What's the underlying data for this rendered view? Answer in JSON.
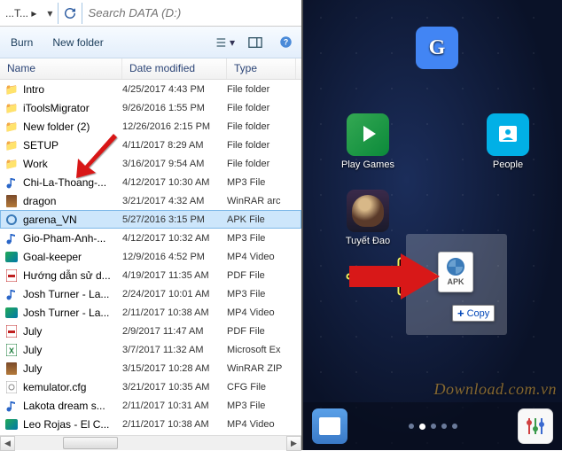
{
  "addr": {
    "crumb": "...T... ▸",
    "search_placeholder": "Search DATA (D:)"
  },
  "toolbar": {
    "burn": "Burn",
    "newfolder": "New folder"
  },
  "headers": {
    "name": "Name",
    "date": "Date modified",
    "type": "Type"
  },
  "files": [
    {
      "icon": "folder",
      "name": "Intro",
      "date": "4/25/2017 4:43 PM",
      "type": "File folder"
    },
    {
      "icon": "folder",
      "name": "iToolsMigrator",
      "date": "9/26/2016 1:55 PM",
      "type": "File folder"
    },
    {
      "icon": "folder",
      "name": "New folder (2)",
      "date": "12/26/2016 2:15 PM",
      "type": "File folder"
    },
    {
      "icon": "folder",
      "name": "SETUP",
      "date": "4/11/2017 8:29 AM",
      "type": "File folder"
    },
    {
      "icon": "folder",
      "name": "Work",
      "date": "3/16/2017 9:54 AM",
      "type": "File folder"
    },
    {
      "icon": "mp3",
      "name": "Chi-La-Thoang-...",
      "date": "4/12/2017 10:30 AM",
      "type": "MP3 File"
    },
    {
      "icon": "rar",
      "name": "dragon",
      "date": "3/21/2017 4:32 AM",
      "type": "WinRAR arc"
    },
    {
      "icon": "apk",
      "name": "garena_VN",
      "date": "5/27/2016 3:15 PM",
      "type": "APK File",
      "selected": true
    },
    {
      "icon": "mp3",
      "name": "Gio-Pham-Anh-...",
      "date": "4/12/2017 10:32 AM",
      "type": "MP3 File"
    },
    {
      "icon": "mp4",
      "name": "Goal-keeper",
      "date": "12/9/2016 4:52 PM",
      "type": "MP4 Video"
    },
    {
      "icon": "pdf",
      "name": "Hướng dẫn sử d...",
      "date": "4/19/2017 11:35 AM",
      "type": "PDF File"
    },
    {
      "icon": "mp3",
      "name": "Josh Turner - La...",
      "date": "2/24/2017 10:01 AM",
      "type": "MP3 File"
    },
    {
      "icon": "mp4",
      "name": "Josh Turner - La...",
      "date": "2/11/2017 10:38 AM",
      "type": "MP4 Video"
    },
    {
      "icon": "pdf",
      "name": "July",
      "date": "2/9/2017 11:47 AM",
      "type": "PDF File"
    },
    {
      "icon": "xls",
      "name": "July",
      "date": "3/7/2017 11:32 AM",
      "type": "Microsoft Ex"
    },
    {
      "icon": "rar",
      "name": "July",
      "date": "3/15/2017 10:28 AM",
      "type": "WinRAR ZIP"
    },
    {
      "icon": "cfg",
      "name": "kemulator.cfg",
      "date": "3/21/2017 10:35 AM",
      "type": "CFG File"
    },
    {
      "icon": "mp3",
      "name": "Lakota dream s...",
      "date": "2/11/2017 10:31 AM",
      "type": "MP3 File"
    },
    {
      "icon": "mp4",
      "name": "Leo Rojas - El C...",
      "date": "2/11/2017 10:38 AM",
      "type": "MP4 Video"
    }
  ],
  "apps": {
    "google": "",
    "playgames": "Play Games",
    "people": "People",
    "tuyetdao": "Tuyết Đao"
  },
  "apk_label": "APK",
  "copy_label": "Copy",
  "watermark": "Download.com.vn"
}
